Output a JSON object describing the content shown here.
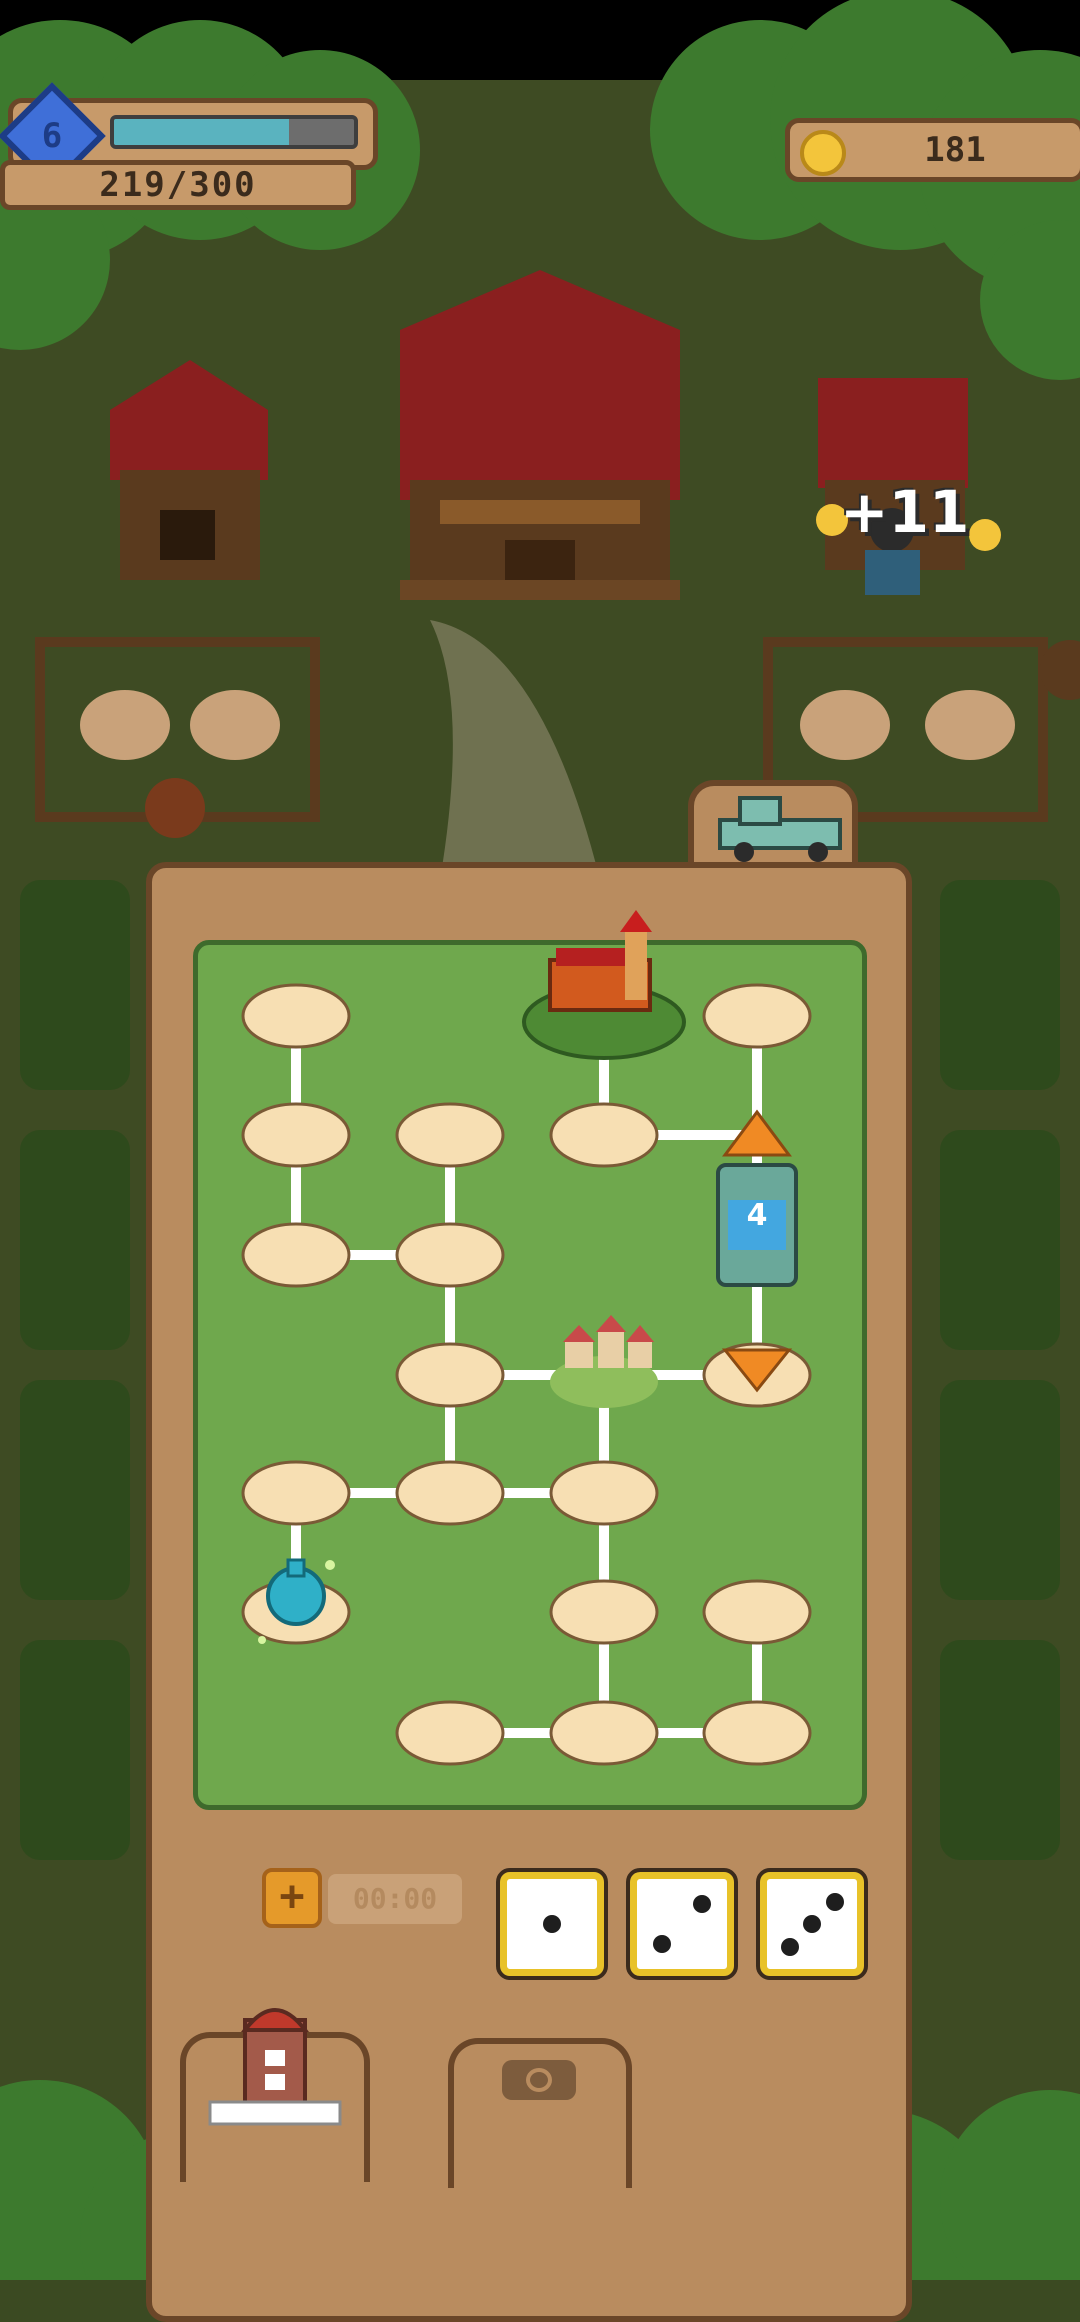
{
  "hud": {
    "level": "6",
    "xp_text": "219/300",
    "xp_fraction": 0.73,
    "coins": "181",
    "floating_reward": "+11"
  },
  "timer": {
    "label": "00:00"
  },
  "dice": [
    1,
    2,
    3
  ],
  "board": {
    "player_token_number": "4"
  },
  "colors": {
    "grass": "#6fa84d",
    "panel": "#b98c5f",
    "panel_border": "#6a4628",
    "node": "#f7dfb3",
    "die_border": "#e8c229",
    "xp_fill": "#5ab3bf",
    "level_gem": "#3f6fd8"
  },
  "icons": {
    "coin": "coin-icon",
    "level": "level-gem-icon",
    "timer_add": "plus-icon",
    "camera": "camera-icon",
    "silo": "silo-icon",
    "truck": "truck-icon"
  }
}
